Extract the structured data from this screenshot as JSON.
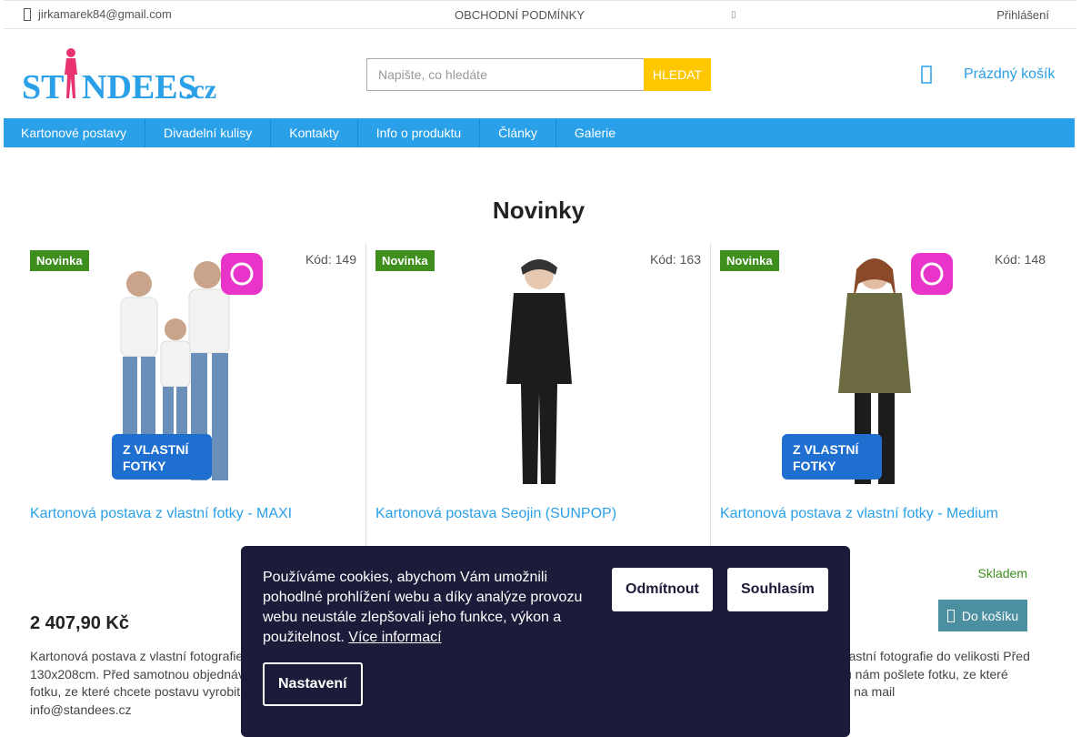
{
  "topbar": {
    "email": "jirkamarek84@gmail.com",
    "terms": "OBCHODNÍ PODMÍNKY",
    "dot": "▯",
    "login": "Přihlášení"
  },
  "logo": {
    "text_main": "ST",
    "text_rest": "NDEES",
    "tld": ".cz"
  },
  "search": {
    "placeholder": "Napište, co hledáte",
    "button_label": "HLEDAT"
  },
  "cart": {
    "label": "Prázdný košík"
  },
  "nav": {
    "items": [
      "Kartonové postavy",
      "Divadelní kulisy",
      "Kontakty",
      "Info o produktu",
      "Články",
      "Galerie"
    ]
  },
  "page": {
    "heading": "Novinky"
  },
  "products": [
    {
      "badge": "Novinka",
      "code": "Kód: 149",
      "title": "Kartonová postava z vlastní fotky - MAXI",
      "price": "2 407,90 Kč",
      "desc": "Kartonová postava z vlastní fotografie do velikosti 130x208cm. Před samotnou objednávkou nám pošlete fotku, ze které chcete postavu vyrobit, na mail info@standees.cz",
      "overlay": "Z VLASTNÍ FOTKY"
    },
    {
      "badge": "Novinka",
      "code": "Kód: 163",
      "title": "Kartonová postava Seojin (SUNPOP)"
    },
    {
      "badge": "Novinka",
      "code": "Kód: 148",
      "title": "Kartonová postava z vlastní fotky - Medium",
      "stock": "Skladem",
      "add_to_cart": "Do košíku",
      "desc": "Kartonová postava z vlastní fotografie do velikosti Před samotnou objednávkou nám pošlete fotku, ze které chcete postavu vyrobit, na mail",
      "overlay": "Z VLASTNÍ FOTKY"
    }
  ],
  "cookie": {
    "text": "Používáme cookies, abychom Vám umožnili pohodlné prohlížení webu a díky analýze provozu webu neustále zlepšovali jeho funkce, výkon a použitelnost.",
    "more_info": "Více informací",
    "reject": "Odmítnout",
    "accept": "Souhlasím",
    "settings": "Nastavení"
  },
  "colors": {
    "accent": "#2aa0e8",
    "search_button": "#ffc700",
    "badge": "#3e8f1e",
    "logo_pink": "#e8336f",
    "cookie_bg": "#1c1b3a"
  }
}
